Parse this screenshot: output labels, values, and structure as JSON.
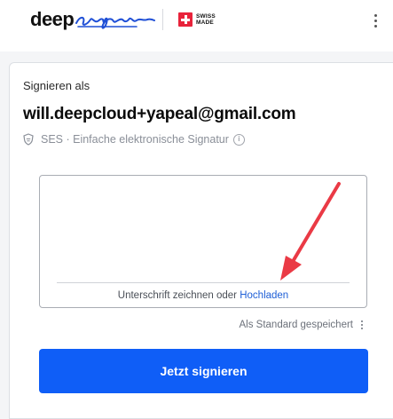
{
  "header": {
    "logo_text": "deepsign",
    "logo_wordmark_part1": "deep",
    "badge_line1": "SWISS",
    "badge_line2": "MADE",
    "menu_icon": "kebab-vertical-icon"
  },
  "signing": {
    "label": "Signieren als",
    "email": "will.deepcloud+yapeal@gmail.com",
    "signature_type": "SES · Einfache elektronische Signatur",
    "type_icon": "shield-badge-icon",
    "info_icon": "info-circle-icon",
    "info_glyph": "i"
  },
  "signature_pad": {
    "caption_prefix": "Unterschrift zeichnen oder",
    "upload_link": "Hochladen"
  },
  "saved_default": "Als Standard gespeichert",
  "submit_button": "Jetzt signieren",
  "colors": {
    "primary": "#0f5ef7",
    "link": "#1f5fd6",
    "annotation_arrow": "#ea3a45",
    "swiss_red": "#e8233b"
  }
}
